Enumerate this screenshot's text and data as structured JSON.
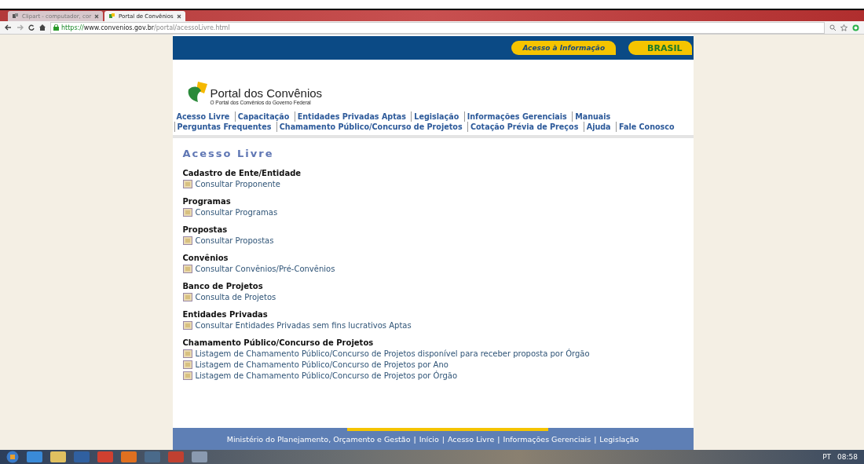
{
  "browser": {
    "tabs": [
      {
        "label": "Clipart - computador, cor",
        "selected": false
      },
      {
        "label": "Portal de Convênios",
        "selected": true
      }
    ],
    "url": {
      "scheme": "https://",
      "host": "www.convenios.gov.br",
      "path": "/portal/acessoLivre.html"
    }
  },
  "banner": {
    "access_label": "Acesso à Informação",
    "brasil": "BRASIL"
  },
  "logo": {
    "title": "Portal dos Convênios",
    "subtitle": "O Portal dos Convênios do Governo Federal"
  },
  "nav": [
    "Acesso Livre",
    "Capacitação",
    "Entidades Privadas Aptas",
    "Legislação",
    "Informações Gerenciais",
    "Manuais",
    "Perguntas Frequentes",
    "Chamamento Público/Concurso de Projetos",
    "Cotação Prévia de Preços",
    "Ajuda",
    "Fale Conosco"
  ],
  "heading": "Acesso Livre",
  "sections": [
    {
      "title": "Cadastro de Ente/Entidade",
      "links": [
        "Consultar Proponente"
      ]
    },
    {
      "title": "Programas",
      "links": [
        "Consultar Programas"
      ]
    },
    {
      "title": "Propostas",
      "links": [
        "Consultar Propostas"
      ]
    },
    {
      "title": "Convênios",
      "links": [
        "Consultar Convênios/Pré-Convênios"
      ]
    },
    {
      "title": "Banco de Projetos",
      "links": [
        "Consulta de Projetos"
      ]
    },
    {
      "title": "Entidades Privadas",
      "links": [
        "Consultar Entidades Privadas sem fins lucrativos Aptas"
      ]
    },
    {
      "title": "Chamamento Público/Concurso de Projetos",
      "links": [
        "Listagem de Chamamento Público/Concurso de Projetos disponível para receber proposta por Órgão",
        "Listagem de Chamamento Público/Concurso de Projetos por Ano",
        "Listagem de Chamamento Público/Concurso de Projetos por Órgão"
      ]
    }
  ],
  "footer": {
    "separator": "|",
    "links": [
      "Ministério do Planejamento, Orçamento e Gestão",
      "Início",
      "Acesso Livre",
      "Informações Gerenciais",
      "Legislação"
    ]
  },
  "tray": {
    "language": "PT",
    "time": "08:58"
  }
}
